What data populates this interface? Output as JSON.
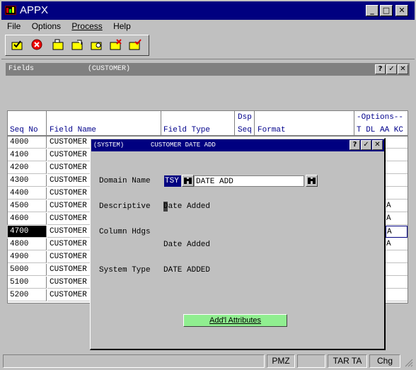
{
  "app": {
    "title": "APPX"
  },
  "menu": [
    "File",
    "Options",
    "Process",
    "Help"
  ],
  "toolbar_icons": [
    "check-folder-icon",
    "stop-icon",
    "open-folder-icon",
    "folder-edit-icon",
    "folder-search-icon",
    "folder-delete-icon",
    "folder-check-icon"
  ],
  "fields_window": {
    "title": "Fields",
    "subtitle": "(CUSTOMER)",
    "help_btn": "?",
    "ok_btn": "✓",
    "close_btn": "✕"
  },
  "table": {
    "headers": {
      "seq_no": "Seq No",
      "field_name": "Field Name",
      "field_type": "Field Type",
      "dsp": "Dsp",
      "seq": "Seq",
      "format": "Format",
      "options": "-Options--",
      "options_cols": "T DL AA KC"
    },
    "rows": [
      {
        "seq": "4000",
        "name": "CUSTOMER",
        "opt": ""
      },
      {
        "seq": "4100",
        "name": "CUSTOMER",
        "opt": ""
      },
      {
        "seq": "4200",
        "name": "CUSTOMER",
        "opt": ""
      },
      {
        "seq": "4300",
        "name": "CUSTOMER",
        "opt": ""
      },
      {
        "seq": "4400",
        "name": "CUSTOMER",
        "opt": ""
      },
      {
        "seq": "4500",
        "name": "CUSTOMER",
        "opt": "A"
      },
      {
        "seq": "4600",
        "name": "CUSTOMER",
        "opt": "A"
      },
      {
        "seq": "4700",
        "name": "CUSTOMER",
        "opt": "A"
      },
      {
        "seq": "4800",
        "name": "CUSTOMER",
        "opt": "A"
      },
      {
        "seq": "4900",
        "name": "CUSTOMER",
        "opt": ""
      },
      {
        "seq": "5000",
        "name": "CUSTOMER",
        "opt": ""
      },
      {
        "seq": "5100",
        "name": "CUSTOMER",
        "opt": ""
      },
      {
        "seq": "5200",
        "name": "CUSTOMER",
        "opt": ""
      }
    ],
    "selected_index": 7
  },
  "dialog": {
    "system": "(SYSTEM)",
    "title": "CUSTOMER DATE ADD",
    "help_btn": "?",
    "ok_btn": "✓",
    "close_btn": "✕",
    "domain_label": "Domain Name",
    "domain_app": "TSY",
    "domain_name": "DATE ADD",
    "descriptive_label": "Descriptive",
    "descriptive_value": "Date Added",
    "column_hdgs_label": "Column Hdgs",
    "column_hdg_value": "Date Added",
    "system_type_label": "System Type",
    "system_type_value": "DATE ADDED",
    "attributes_button": "Add'l Attributes"
  },
  "status_bar": [
    "",
    "PMZ",
    "",
    "TAR TA",
    "Chg"
  ],
  "colors": {
    "titlebar": "#000080",
    "button_green": "#90ee90",
    "selection": "#000080"
  }
}
